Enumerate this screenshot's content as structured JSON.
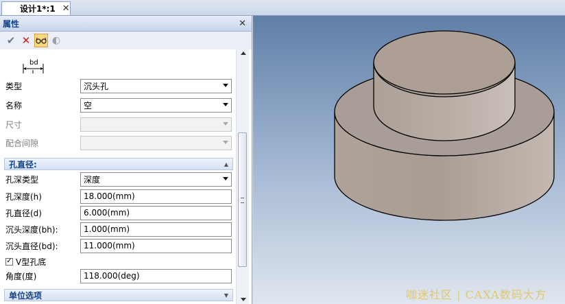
{
  "doc_tab": {
    "title": "设计1*:1",
    "close": "✕"
  },
  "panel": {
    "title": "属性",
    "close": "✕",
    "toolbar": {
      "ok": "✔",
      "cancel": "✕",
      "preview": "👓",
      "extra": "◐"
    },
    "diagram_label": "bd",
    "fields": {
      "type": {
        "label": "类型",
        "value": "沉头孔"
      },
      "name": {
        "label": "名称",
        "value": "空"
      },
      "size": {
        "label": "尺寸",
        "value": ""
      },
      "fit": {
        "label": "配合间隙",
        "value": ""
      }
    },
    "section_hole": {
      "title": "孔直径:",
      "depth_type": {
        "label": "孔深类型",
        "value": "深度"
      },
      "depth": {
        "label": "孔深度(h)",
        "value": "18.000(mm)"
      },
      "diameter": {
        "label": "孔直径(d)",
        "value": "6.000(mm)"
      },
      "cb_depth": {
        "label": "沉头深度(bh):",
        "value": "1.000(mm)"
      },
      "cb_diameter": {
        "label": "沉头直径(bd):",
        "value": "11.000(mm)"
      },
      "vbottom": {
        "label": "V型孔底",
        "checked": true,
        "mark": "✓"
      },
      "angle": {
        "label": "角度(度)",
        "value": "118.000(deg)"
      }
    },
    "section_unit": {
      "title": "单位选项"
    }
  },
  "viewport": {
    "watermark": "咖迷社区 | CAXA数码大方"
  }
}
